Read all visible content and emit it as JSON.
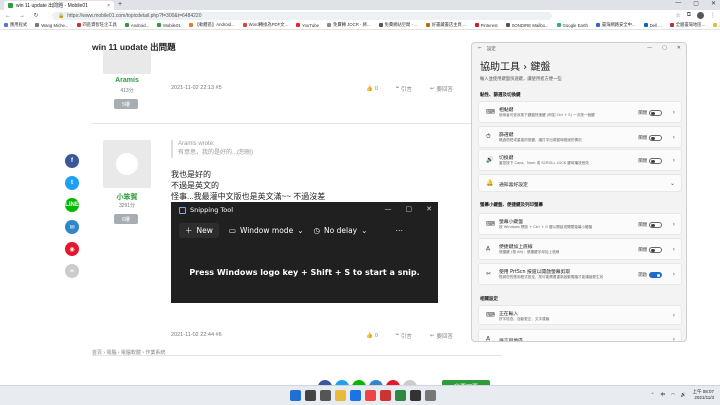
{
  "browser": {
    "tab_title": "win 11 update 出問題 - Mobile01",
    "tab_close": "×",
    "new_tab": "+",
    "url": "https://www.mobile01.com/topicdetail.php?f=300&t=6484220",
    "window_controls": [
      "—",
      "▢",
      "✕"
    ],
    "bookmarks": [
      {
        "label": "應用程式",
        "color": "#4a7bd0"
      },
      {
        "label": "Wang Miche...",
        "color": "#777"
      },
      {
        "label": "四區資智旺企工具",
        "color": "#c33"
      },
      {
        "label": "Android...",
        "color": "#2e9b3c"
      },
      {
        "label": "Mobile01",
        "color": "#2e9b3c"
      },
      {
        "label": "【軟體區】Android...",
        "color": "#e67e22"
      },
      {
        "label": "Word轉換為PDF文...",
        "color": "#d43"
      },
      {
        "label": "YouTube",
        "color": "#e22"
      },
      {
        "label": "免費轉 JOCR - 將...",
        "color": "#888"
      },
      {
        "label": "免費網站空間 - ...",
        "color": "#555"
      },
      {
        "label": "好書藏書店主頁 ...",
        "color": "#c60"
      },
      {
        "label": "Pinterest",
        "color": "#c22"
      },
      {
        "label": "SONDIRE Mailbo...",
        "color": "#555"
      },
      {
        "label": "Google Earth",
        "color": "#3a8"
      },
      {
        "label": "臺灣網路安全中...",
        "color": "#36c"
      },
      {
        "label": "Dell ...",
        "color": "#06c"
      },
      {
        "label": "全國臺灣地區...",
        "color": "#b33"
      },
      {
        "label": "其他書籤",
        "color": "#e8b93a"
      }
    ]
  },
  "page": {
    "title": "win 11 update 出問題",
    "post1": {
      "user": "Aramis",
      "count": "413分",
      "badge": "5樓",
      "time": "2021-11-02 22:13 #5",
      "like": "0",
      "quote": "引言",
      "report": "要回答"
    },
    "post2": {
      "user": "小笨賀",
      "count": "3291分",
      "badge": "6樓",
      "quote_head": "Aramis wrote:",
      "quote_text": "有意思，我的是好的...(恕刪)",
      "lines": [
        "我也是好的",
        "不過是英文的",
        "怪事...我最灌中文版也是英文滿~~ 不過沒差"
      ],
      "time": "2021-11-02 22:44 #6",
      "like": "0",
      "quote": "引言",
      "report": "要回答"
    },
    "breadcrumb": "首頁 › 電腦 › 電腦軟體 › 作業系統",
    "reply_button": "我要回覆",
    "social": [
      {
        "label": "f",
        "color": "#3b5998"
      },
      {
        "label": "t",
        "color": "#1da1f2"
      },
      {
        "label": "LINE",
        "color": "#00b900"
      },
      {
        "label": "✉",
        "color": "#2f86c8"
      },
      {
        "label": "◉",
        "color": "#e6162d"
      },
      {
        "label": "⚭",
        "color": "#ccc"
      }
    ]
  },
  "snipping": {
    "title": "Snipping Tool",
    "new_label": "New",
    "mode_label": "Window mode",
    "delay_label": "No delay",
    "more": "⋯",
    "message": "Press Windows logo key + Shift + S to start a snip.",
    "controls": [
      "—",
      "▢",
      "✕"
    ]
  },
  "settings": {
    "app": "設定",
    "breadcrumb": "協助工具 › 鍵盤",
    "description": "輸入並使用鍵盤快速鍵，讓使用者方便一些",
    "section1": "黏性、篩選及切換鍵",
    "items1": [
      {
        "title": "相黏鍵",
        "desc": "使用者可依序按下鍵盤快速鍵 (例如 Ctrl + S) 一次按一個鍵",
        "state": "關閉",
        "on": false,
        "icon": "⌨"
      },
      {
        "title": "篩選鍵",
        "desc": "略過簡短或重複的按鍵，讓打字出現暫時錯誤的情況",
        "state": "關閉",
        "on": false,
        "icon": "⏱"
      },
      {
        "title": "切換鍵",
        "desc": "當您按下 Caps、Num 或 SCROLL LOCK 鍵時播放音效",
        "state": "關閉",
        "on": false,
        "icon": "🔊"
      },
      {
        "title": "通知喜好設定",
        "desc": "",
        "state": "",
        "on": null,
        "icon": "🔔"
      }
    ],
    "section2": "螢幕小鍵盤、便捷鍵及列印螢幕",
    "items2": [
      {
        "title": "螢幕小鍵盤",
        "desc": "按 Windows 標誌 + Ctrl + O 鍵以開啟或關閉螢幕小鍵盤",
        "state": "關閉",
        "on": false,
        "icon": "⌨"
      },
      {
        "title": "便捷鍵加上底線",
        "desc": "便捷鍵 (按 Alt)：便捷鍵字母加上底線",
        "state": "關閉",
        "on": false,
        "icon": "A"
      },
      {
        "title": "使用 PrtScn 按鈕以開啟螢幕剪取",
        "desc": "根據您的應用程式設定，您可能需要重新啟動電腦才能讓變更生效",
        "state": "開啟",
        "on": true,
        "icon": "✂"
      }
    ],
    "section3": "相關設定",
    "items3": [
      {
        "title": "正在輸入",
        "desc": "拼字檢查、自動更正、文字建議",
        "icon": "⌨"
      },
      {
        "title": "語言與地區",
        "desc": "",
        "icon": "A"
      }
    ]
  },
  "taskbar": {
    "time": "上午 08:07",
    "date": "2021/11/3",
    "lang": "中"
  }
}
